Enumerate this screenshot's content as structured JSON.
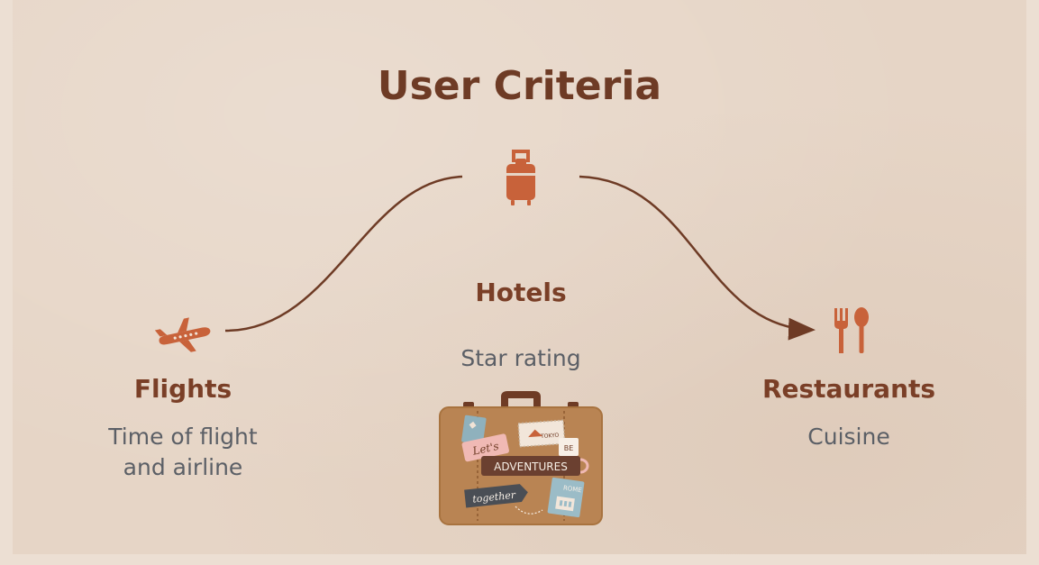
{
  "title": "User Criteria",
  "items": [
    {
      "heading": "Flights",
      "desc_line1": "Time of flight",
      "desc_line2": "and airline"
    },
    {
      "heading": "Hotels",
      "desc_line1": "Star rating"
    },
    {
      "heading": "Restaurants",
      "desc_line1": "Cuisine"
    }
  ],
  "suitcase_stickers": {
    "lets": "Let's",
    "tokyo": "TOKYO",
    "be": "BE",
    "adventures": "ADVENTURES",
    "together": "together",
    "rome": "ROME"
  },
  "colors": {
    "background": "#e6d5c6",
    "accent": "#c8623a",
    "heading": "#7a3f27",
    "text": "#5b5f66",
    "line": "#6e3b25"
  }
}
